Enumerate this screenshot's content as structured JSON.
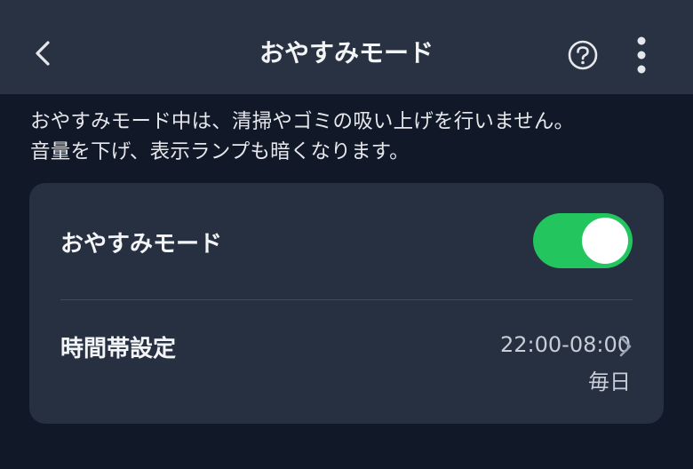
{
  "header": {
    "title": "おやすみモード",
    "back_icon": "chevron-left-icon",
    "help_icon": "question-circle-icon",
    "more_icon": "more-vertical-icon"
  },
  "description": {
    "line1": "おやすみモード中は、清掃やゴミの吸い上げを行いません。",
    "line2": "音量を下げ、表示ランプも暗くなります。"
  },
  "settings": {
    "sleep_mode": {
      "label": "おやすみモード",
      "enabled": true
    },
    "time_range": {
      "label": "時間帯設定",
      "value": "22:00-08:00",
      "repeat": "毎日",
      "icon": "chevron-right-icon"
    }
  },
  "colors": {
    "background": "#111827",
    "header": "#283242",
    "card": "#263041",
    "toggle_on": "#22c55e",
    "text_primary": "#f3f4f6",
    "text_secondary": "#c9ced6"
  }
}
